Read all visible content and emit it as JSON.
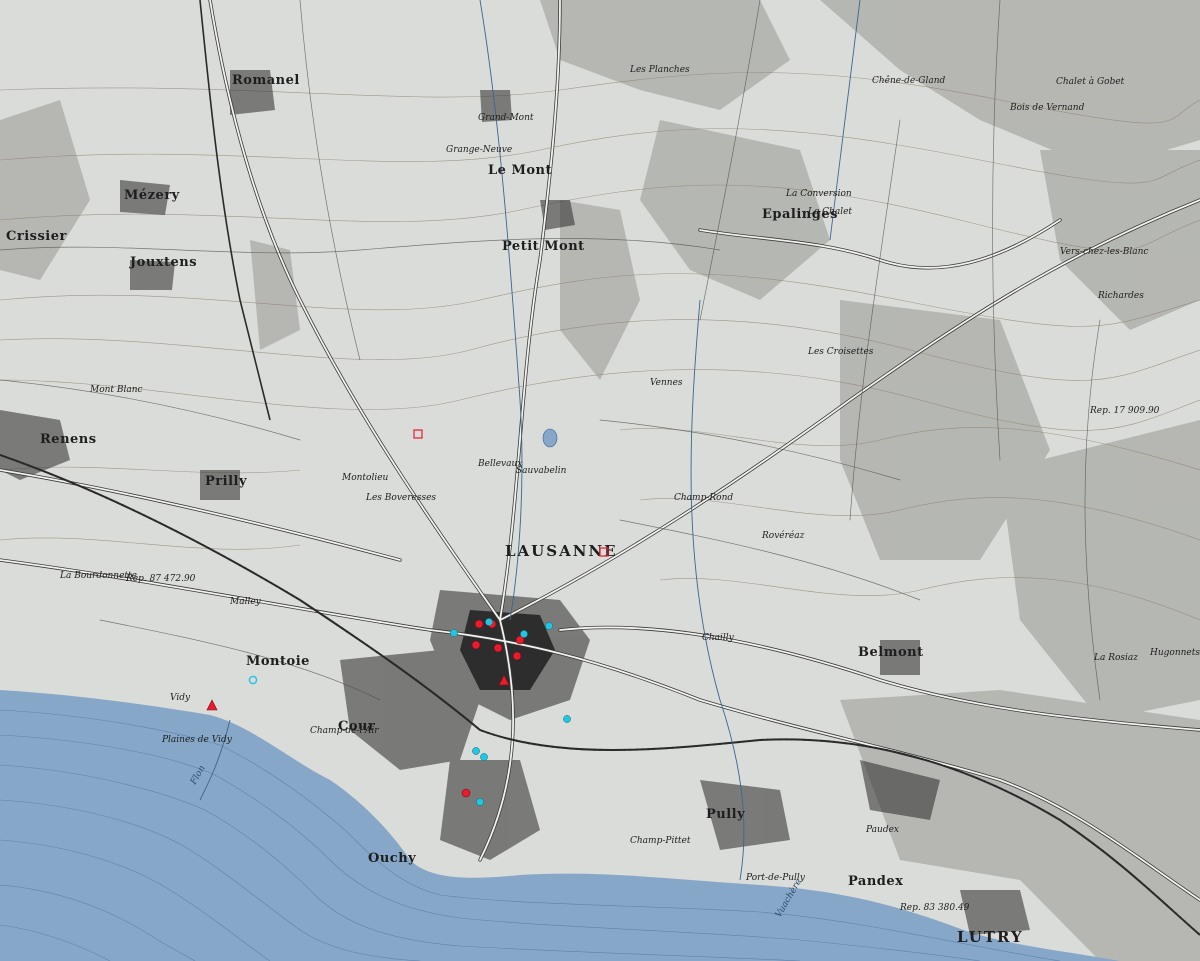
{
  "map": {
    "colors": {
      "paper": "#d9dcd8",
      "lake": "#86a7c8",
      "lake_contour": "#3c6590",
      "relief": "#a9aba6",
      "contour": "#8c7a62",
      "road": "#f2f2ee",
      "road_casing": "#3a3a3a",
      "rail": "#2a2a2a",
      "urban": "#2b2b2b",
      "marker_red": "#e81c2e",
      "marker_cyan": "#22c6e0"
    },
    "places_major": [
      {
        "name": "LAUSANNE"
      },
      {
        "name": "LUTRY"
      }
    ],
    "places_towns": [
      {
        "name": "Romanel"
      },
      {
        "name": "Jouxtens"
      },
      {
        "name": "Renens"
      },
      {
        "name": "Prilly"
      },
      {
        "name": "Pully"
      },
      {
        "name": "Belmont"
      },
      {
        "name": "Epalinges"
      },
      {
        "name": "Le Mont"
      },
      {
        "name": "Petit Mont"
      },
      {
        "name": "Mézery"
      },
      {
        "name": "Ouchy"
      },
      {
        "name": "Pandex"
      },
      {
        "name": "Cour"
      },
      {
        "name": "Montoie"
      },
      {
        "name": "Crissier"
      }
    ],
    "places_localities": [
      {
        "name": "Grand-Mont"
      },
      {
        "name": "Les Planches"
      },
      {
        "name": "Chalet à Gobet"
      },
      {
        "name": "Chêne-de-Gland"
      },
      {
        "name": "Les Croisettes"
      },
      {
        "name": "Vennes"
      },
      {
        "name": "Chailly"
      },
      {
        "name": "Rovéréaz"
      },
      {
        "name": "Bois de Vernand"
      },
      {
        "name": "Vers-chez-les-Blanc"
      },
      {
        "name": "Richardes"
      },
      {
        "name": "Mont Blanc"
      },
      {
        "name": "Bellevaux"
      },
      {
        "name": "Montolieu"
      },
      {
        "name": "Les Boveresses"
      },
      {
        "name": "Malley"
      },
      {
        "name": "Vidy"
      },
      {
        "name": "La Bourdonnette"
      },
      {
        "name": "Plaines de Vidy"
      },
      {
        "name": "Port-de-Pully"
      },
      {
        "name": "Champ-Pittet"
      },
      {
        "name": "Grange-Neuve"
      },
      {
        "name": "Champ-de-l'Air"
      },
      {
        "name": "Sauvabelin"
      },
      {
        "name": "Paudex"
      },
      {
        "name": "La Conversion"
      },
      {
        "name": "Champ-Rond"
      },
      {
        "name": "Hugonnets"
      },
      {
        "name": "Le Chalet"
      },
      {
        "name": "La Rosiaz"
      },
      {
        "name": "Rep. 87 472.90"
      },
      {
        "name": "Rep. 17 909.90"
      },
      {
        "name": "Rep. 83 380.49"
      }
    ],
    "water_labels": [
      {
        "name": "Flon"
      },
      {
        "name": "Vuachère"
      }
    ],
    "markers_red": [
      {
        "id": "r1"
      },
      {
        "id": "r2"
      },
      {
        "id": "r3"
      },
      {
        "id": "r4"
      },
      {
        "id": "r5"
      },
      {
        "id": "r6"
      },
      {
        "id": "r7"
      },
      {
        "id": "r8"
      },
      {
        "id": "r9"
      }
    ],
    "markers_cyan": [
      {
        "id": "c1"
      },
      {
        "id": "c2"
      },
      {
        "id": "c3"
      },
      {
        "id": "c4"
      },
      {
        "id": "c5"
      },
      {
        "id": "c6"
      },
      {
        "id": "c7"
      },
      {
        "id": "c8"
      },
      {
        "id": "c9"
      }
    ],
    "markers_open_red": [
      {
        "id": "s1"
      },
      {
        "id": "s2"
      }
    ]
  }
}
